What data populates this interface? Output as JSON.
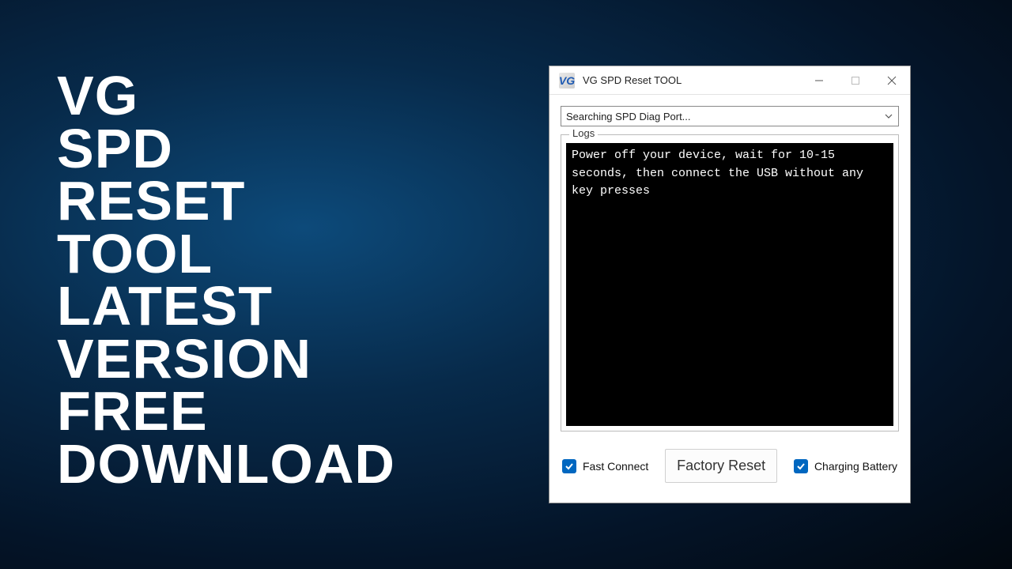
{
  "hero": {
    "lines": [
      "VG",
      "SPD",
      "RESET",
      "TOOL",
      "LATEST",
      "VERSION",
      "FREE",
      "DOWNLOAD"
    ]
  },
  "window": {
    "icon_text": "VG",
    "title": "VG SPD Reset TOOL",
    "port_dropdown_value": "Searching SPD Diag Port...",
    "logs_legend": "Logs",
    "logs_text": "Power off your device, wait for 10-15 seconds, then connect the USB without any key presses",
    "checkbox_fast_label": "Fast Connect",
    "checkbox_charge_label": "Charging Battery",
    "factory_button_label": "Factory Reset"
  }
}
